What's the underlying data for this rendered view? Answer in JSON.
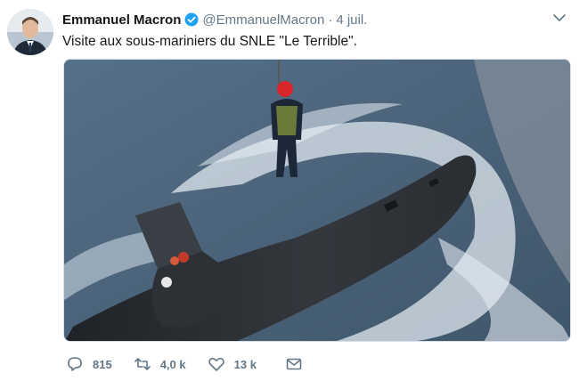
{
  "author": {
    "name": "Emmanuel Macron",
    "handle": "@EmmanuelMacron",
    "separator": "·",
    "time": "4 juil."
  },
  "tweet": {
    "text": "Visite aux sous-mariniers du SNLE \"Le Terrible\"."
  },
  "actions": {
    "replies": "815",
    "retweets": "4,0 k",
    "likes": "13 k"
  },
  "colors": {
    "verified": "#1da1f2",
    "icon": "#657786",
    "sea": "#4a6378",
    "submarine": "#2a2d31"
  },
  "icons": [
    "verified-icon",
    "chevron-down-icon",
    "reply-icon",
    "retweet-icon",
    "like-icon",
    "message-icon"
  ]
}
